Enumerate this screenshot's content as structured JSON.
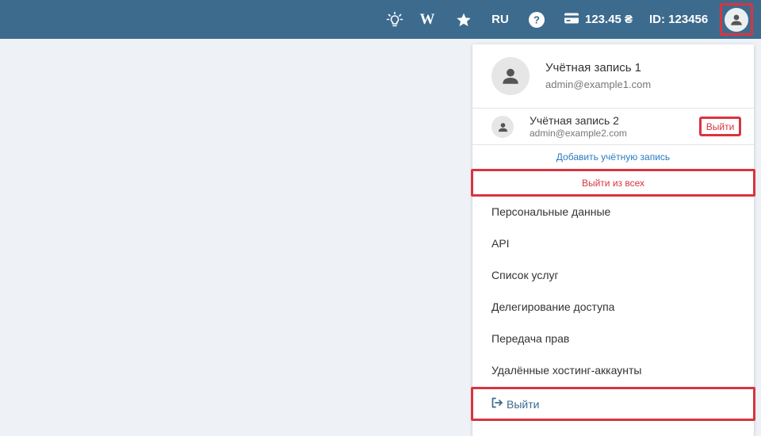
{
  "topbar": {
    "language": "RU",
    "wiki_label": "W",
    "balance": "123.45 ₴",
    "client_id": "ID: 123456",
    "icons": [
      "lightbulb-icon",
      "wiki-icon",
      "star-icon",
      "help-icon",
      "credit-card-icon",
      "user-icon"
    ]
  },
  "account_menu": {
    "current_account": {
      "name": "Учётная запись 1",
      "email": "admin@example1.com"
    },
    "other_account": {
      "name": "Учётная запись 2",
      "email": "admin@example2.com",
      "logout_label": "Выйти"
    },
    "add_account_label": "Добавить учётную запись",
    "logout_all_label": "Выйти из всех",
    "items": [
      "Персональные данные",
      "API",
      "Список услуг",
      "Делегирование доступа",
      "Передача прав",
      "Удалённые хостинг-аккаунты"
    ],
    "logout_label": "Выйти"
  },
  "colors": {
    "header_bg": "#3d6b8e",
    "page_bg": "#eef2f6",
    "highlight": "#d9343f",
    "link": "#2a7bbf"
  }
}
